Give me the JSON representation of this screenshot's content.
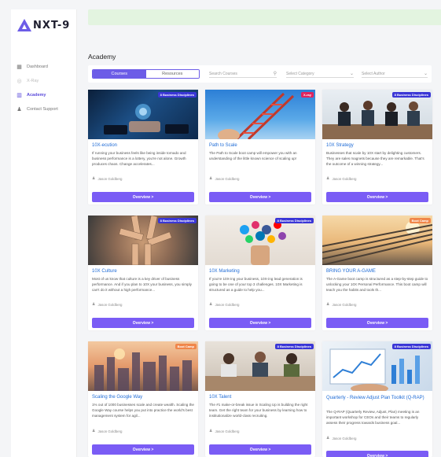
{
  "app": {
    "logo_text": "NXT-9"
  },
  "sidebar": {
    "items": [
      {
        "label": "Dashboard",
        "icon": "grid-icon",
        "state": "normal"
      },
      {
        "label": "X-Ray",
        "icon": "radar-icon",
        "state": "disabled"
      },
      {
        "label": "Academy",
        "icon": "academy-icon",
        "state": "active"
      },
      {
        "label": "Contact Support",
        "icon": "person-icon",
        "state": "normal"
      }
    ]
  },
  "page": {
    "title": "Academy"
  },
  "filters": {
    "tabs": [
      {
        "label": "Courses",
        "active": true
      },
      {
        "label": "Resources",
        "active": false
      }
    ],
    "search_placeholder": "Search Courses",
    "category_placeholder": "Select Category",
    "author_placeholder": "Select Author"
  },
  "colors": {
    "accent": "#6c5ce7",
    "button": "#7a5cf5",
    "link": "#1e6bd6",
    "tag_blue": "#3a36d6",
    "tag_red": "#e0245e",
    "tag_orange": "#f0864a"
  },
  "cards": [
    {
      "tag": "8 Business Disciplines",
      "tag_color": "#3a36d6",
      "title": "10X-ecution",
      "desc": "If running your business feels like being inside tornado and business performance is a lottery, you're not alone. Growth produces chaos. Change accelerates...",
      "author": "Jason Goldberg",
      "button": "Overview >"
    },
    {
      "tag": "X-ray",
      "tag_color": "#e0245e",
      "title": "Path to Scale",
      "desc": "The Path to Scale boot camp will empower you with an understanding of the little known science of scaling up!",
      "author": "Jason Goldberg",
      "button": "Overview >"
    },
    {
      "tag": "8 Business Disciplines",
      "tag_color": "#3a36d6",
      "title": "10X Strategy",
      "desc": "Businesses that scale by 10X start by delighting customers. They are sales magnets because they are remarkable. That's the outcome of a winning strategy...",
      "author": "Jason Goldberg",
      "button": "Overview >"
    },
    {
      "tag": "8 Business Disciplines",
      "tag_color": "#3a36d6",
      "title": "10X Culture",
      "desc": "Most of us know that culture is a key driver of business performance. And if you plan to 10X your business, you simply can't do it without a high performance...",
      "author": "Jason Goldberg",
      "button": "Overview >"
    },
    {
      "tag": "8 Business Disciplines",
      "tag_color": "#3a36d6",
      "title": "10X Marketing",
      "desc": "If you're 10X-ing your business, 10X-ing lead generation is going to be one of your top 3 challenges. 10X Marketing is structured as a guide to help you...",
      "author": "Jason Goldberg",
      "button": "Overview >"
    },
    {
      "tag": "Boot Camp",
      "tag_color": "#f0864a",
      "title": "BRING YOUR A-GAME",
      "desc": "The A-Game boot camp is structured as a step-by-step guide to unlocking your 10X Personal Performance. This boot camp will teach you the habits and tools th...",
      "author": "Jason Goldberg",
      "button": "Overview >"
    },
    {
      "tag": "Boot Camp",
      "tag_color": "#f0864a",
      "title": "Scaling the Google Way",
      "desc": "1% out of 1000 businesses scale and create wealth. Scaling the Google Way course helps you put into practice the world's best management system for agil...",
      "author": "Jason Goldberg",
      "button": "Overview >"
    },
    {
      "tag": "8 Business Disciplines",
      "tag_color": "#3a36d6",
      "title": "10X Talent",
      "desc": "The #1 make-or-break issue in Scaling Up is building the right team. Get the right team for your business by learning how to institutionalize world-class recruiting.",
      "author": "Jason Goldberg",
      "button": "Overview >"
    },
    {
      "tag": "8 Business Disciplines",
      "tag_color": "#3a36d6",
      "title": "Quarterly - Review Adjust Plan Toolkit (Q-RAP)",
      "desc": "The Q-RAP (Quarterly Review, Adjust, Plan) meeting is an important workshop for CEOs and their teams to regularly assess their progress towards business goal...",
      "author": "Jason Goldberg",
      "button": "Overview >"
    }
  ]
}
